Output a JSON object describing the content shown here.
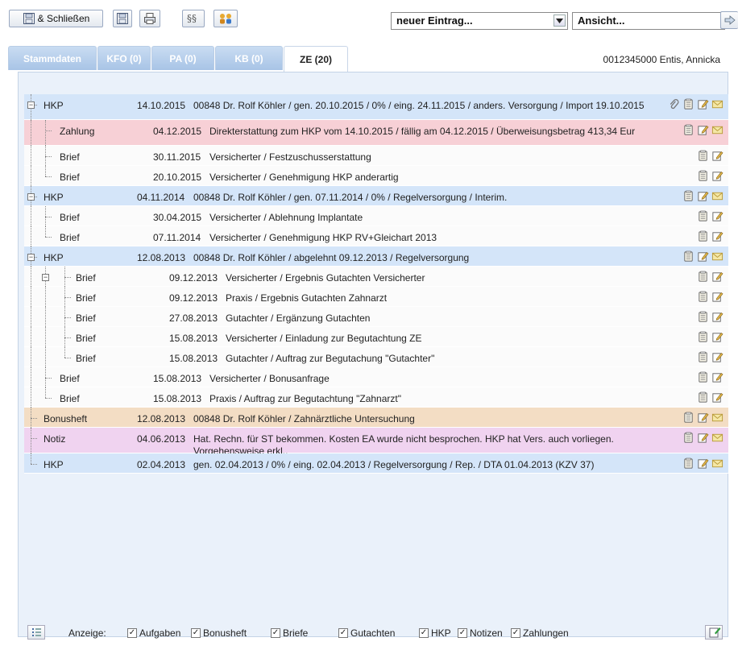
{
  "toolbar": {
    "save_close_label": "& Schließen",
    "entry_combo": "neuer Eintrag...",
    "view_combo": "Ansicht..."
  },
  "tabs": [
    {
      "label": "Stammdaten"
    },
    {
      "label": "KFO (0)"
    },
    {
      "label": "PA (0)"
    },
    {
      "label": "KB (0)"
    },
    {
      "label": "ZE (20)"
    }
  ],
  "patient": "0012345000 Entis, Annicka",
  "rows": [
    {
      "type": "HKP",
      "date": "14.10.2015",
      "desc": "00848 Dr. Rolf Köhler / gen. 20.10.2015 / 0% / eing. 24.11.2015 / anders. Versorgung / Import 19.10.2015"
    },
    {
      "type": "Zahlung",
      "date": "04.12.2015",
      "desc": "Direkterstattung zum HKP vom 14.10.2015 / fällig am 04.12.2015 / Überweisungsbetrag 413,34 Eur"
    },
    {
      "type": "Brief",
      "date": "30.11.2015",
      "desc": "Versicherter / Festzuschusserstattung"
    },
    {
      "type": "Brief",
      "date": "20.10.2015",
      "desc": "Versicherter / Genehmigung HKP anderartig"
    },
    {
      "type": "HKP",
      "date": "04.11.2014",
      "desc": "00848 Dr. Rolf Köhler / gen. 07.11.2014 / 0% / Regelversorgung / Interim."
    },
    {
      "type": "Brief",
      "date": "30.04.2015",
      "desc": "Versicherter / Ablehnung Implantate"
    },
    {
      "type": "Brief",
      "date": "07.11.2014",
      "desc": "Versicherter / Genehmigung HKP RV+Gleichart 2013"
    },
    {
      "type": "HKP",
      "date": "12.08.2013",
      "desc": "00848 Dr. Rolf Köhler / abgelehnt 09.12.2013 / Regelversorgung"
    },
    {
      "type": "Brief",
      "date": "09.12.2013",
      "desc": "Versicherter / Ergebnis Gutachten Versicherter"
    },
    {
      "type": "Brief",
      "date": "09.12.2013",
      "desc": "Praxis / Ergebnis Gutachten Zahnarzt"
    },
    {
      "type": "Brief",
      "date": "27.08.2013",
      "desc": "Gutachter / Ergänzung Gutachten"
    },
    {
      "type": "Brief",
      "date": "15.08.2013",
      "desc": "Versicherter / Einladung zur Begutachtung ZE"
    },
    {
      "type": "Brief",
      "date": "15.08.2013",
      "desc": "Gutachter / Auftrag zur Begutachung \"Gutachter\""
    },
    {
      "type": "Brief",
      "date": "15.08.2013",
      "desc": "Versicherter / Bonusanfrage"
    },
    {
      "type": "Brief",
      "date": "15.08.2013",
      "desc": "Praxis / Auftrag zur Begutachtung \"Zahnarzt\""
    },
    {
      "type": "Bonusheft",
      "date": "12.08.2013",
      "desc": "00848 Dr. Rolf Köhler / Zahnärztliche Untersuchung"
    },
    {
      "type": "Notiz",
      "date": "04.06.2013",
      "desc": "Hat. Rechn. für ST bekommen. Kosten EA wurde nicht besprochen. HKP hat Vers. auch vorliegen. Vorgehensweise erkl.."
    },
    {
      "type": "HKP",
      "date": "02.04.2013",
      "desc": "gen. 02.04.2013 / 0% / eing. 02.04.2013 / Regelversorgung / Rep. / DTA 01.04.2013 (KZV 37)"
    }
  ],
  "bottom": {
    "anzeige_label": "Anzeige:",
    "filters": [
      {
        "label": "Aufgaben",
        "checked": true
      },
      {
        "label": "Bonusheft",
        "checked": true
      },
      {
        "label": "Briefe",
        "checked": true
      },
      {
        "label": "Gutachten",
        "checked": true
      },
      {
        "label": "HKP",
        "checked": true
      },
      {
        "label": "Notizen",
        "checked": true
      },
      {
        "label": "Zahlungen",
        "checked": true
      }
    ]
  },
  "colors": {
    "hkp": "#d4e5f9",
    "zahlung": "#f7d0d6",
    "brief": "#fbfbfb",
    "bonusheft": "#f3ddc4",
    "notiz": "#f0d3f0",
    "tab": "#a8c4e6"
  }
}
